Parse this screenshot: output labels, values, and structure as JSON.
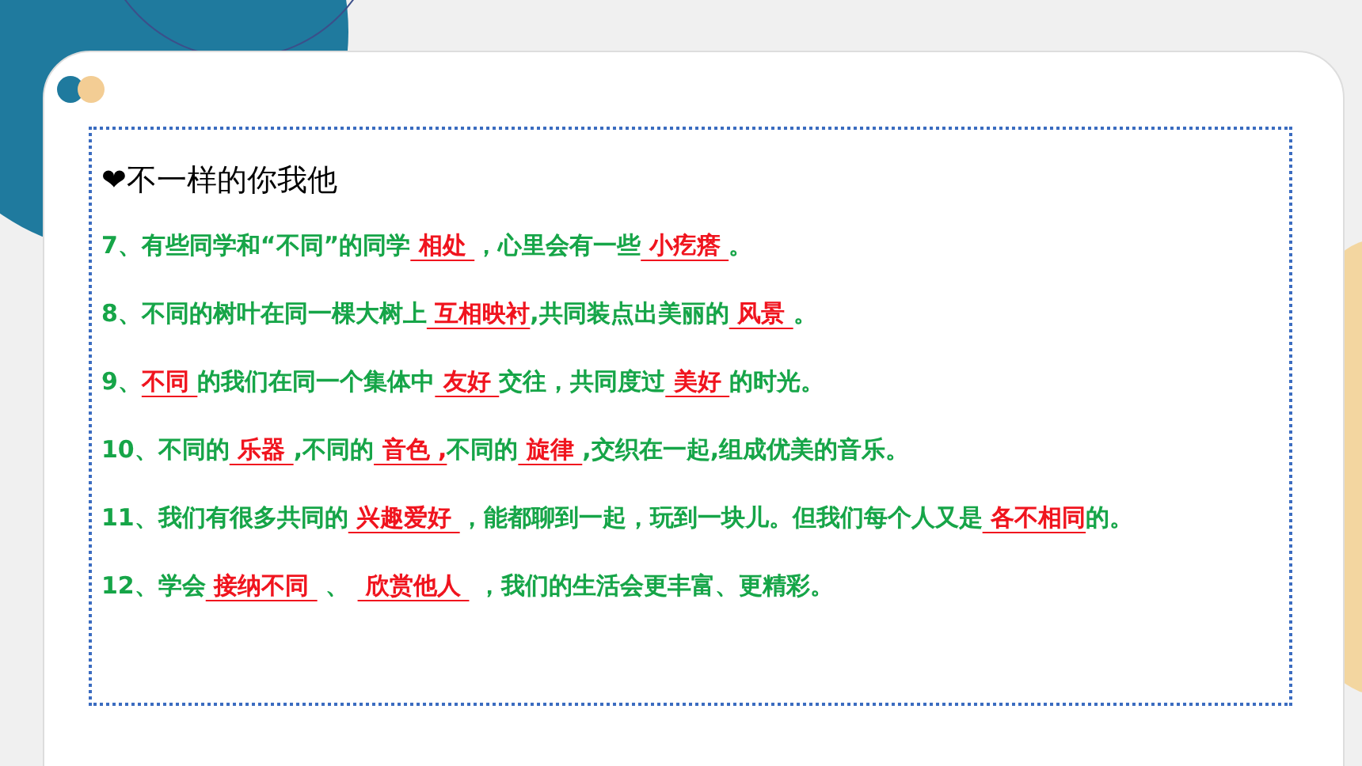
{
  "heading": "❤不一样的你我他",
  "lines": [
    [
      {
        "kind": "text",
        "text": "7、有些同学和“不同”的同学"
      },
      {
        "kind": "answer",
        "text": " 相处 "
      },
      {
        "kind": "text",
        "text": "，心里会有一些"
      },
      {
        "kind": "answer",
        "text": " 小疙瘩 "
      },
      {
        "kind": "text",
        "text": "。"
      }
    ],
    [
      {
        "kind": "text",
        "text": "8、不同的树叶在同一棵大树上"
      },
      {
        "kind": "answer",
        "text": " 互相映衬"
      },
      {
        "kind": "text",
        "text": ",共同装点出美丽的"
      },
      {
        "kind": "answer",
        "text": " 风景 "
      },
      {
        "kind": "text",
        "text": "。"
      }
    ],
    [
      {
        "kind": "text",
        "text": "9、"
      },
      {
        "kind": "answer",
        "text": "不同 "
      },
      {
        "kind": "text",
        "text": "的我们在同一个集体中"
      },
      {
        "kind": "answer",
        "text": " 友好 "
      },
      {
        "kind": "text",
        "text": "交往，共同度过"
      },
      {
        "kind": "answer",
        "text": " 美好 "
      },
      {
        "kind": "text",
        "text": "的时光。"
      }
    ],
    [
      {
        "kind": "text",
        "text": "10、不同的"
      },
      {
        "kind": "answer",
        "text": " 乐器 "
      },
      {
        "kind": "text",
        "text": ",不同的"
      },
      {
        "kind": "answer",
        "text": " 音色 ,"
      },
      {
        "kind": "text",
        "text": "不同的"
      },
      {
        "kind": "answer",
        "text": " 旋律 "
      },
      {
        "kind": "text",
        "text": ",交织在一起,组成优美的音乐。"
      }
    ],
    [
      {
        "kind": "text",
        "text": "11、我们有很多共同的"
      },
      {
        "kind": "answer",
        "text": " 兴趣爱好 "
      },
      {
        "kind": "text",
        "text": "，能都聊到一起，玩到一块儿。但我们每个人又是"
      },
      {
        "kind": "answer",
        "text": " 各不相同"
      },
      {
        "kind": "text",
        "text": "的。"
      }
    ],
    [
      {
        "kind": "text",
        "text": "12、学会"
      },
      {
        "kind": "answer",
        "text": " 接纳不同 "
      },
      {
        "kind": "text",
        "text": " 、 "
      },
      {
        "kind": "answer",
        "text": " 欣赏他人 "
      },
      {
        "kind": "text",
        "text": " ，我们的生活会更丰富、更精彩。"
      }
    ]
  ]
}
